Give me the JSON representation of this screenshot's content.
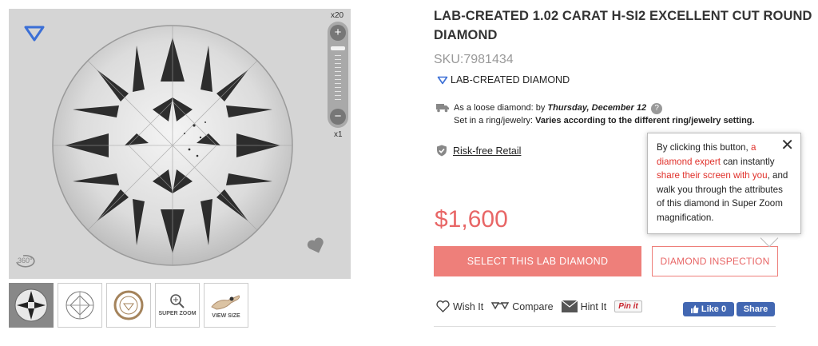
{
  "viewer": {
    "zoom_max_label": "x20",
    "zoom_min_label": "x1",
    "zoom_plus": "+",
    "zoom_minus": "−",
    "rotate_label": "360°"
  },
  "thumbnails": [
    {
      "label": ""
    },
    {
      "label": ""
    },
    {
      "label": ""
    },
    {
      "label": "SUPER ZOOM"
    },
    {
      "label": "VIEW SIZE"
    }
  ],
  "product": {
    "title": "LAB-CREATED 1.02 CARAT H-SI2 EXCELLENT CUT ROUND DIAMOND",
    "sku": "SKU:7981434",
    "lab_tag": "LAB-CREATED DIAMOND",
    "price": "$1,600"
  },
  "shipping": {
    "loose_prefix": "As a loose diamond: by",
    "loose_date": "Thursday, December 12",
    "help": "?",
    "ring_prefix": "Set in a ring/jewelry:",
    "ring_value": "Varies according to the different ring/jewelry setting."
  },
  "risk_free": "Risk-free Retail",
  "buttons": {
    "select": "SELECT THIS LAB DIAMOND",
    "inspection": "DIAMOND INSPECTION"
  },
  "tooltip": {
    "close": "✕",
    "t1": "By clicking this button, ",
    "h1": "a diamond expert",
    "t2": " can instantly ",
    "h2": "share their screen with you",
    "t3": ", and walk you through the attributes of this diamond in Super Zoom magnification."
  },
  "actions": {
    "wish": "Wish It",
    "compare": "Compare",
    "hint": "Hint It",
    "pin": "Pin it",
    "fb_like": "Like 0",
    "fb_share": "Share"
  },
  "colors": {
    "accent": "#ee7f7a",
    "price": "#e86666",
    "facebook": "#4267b2",
    "brand_blue": "#3b6fd6"
  }
}
